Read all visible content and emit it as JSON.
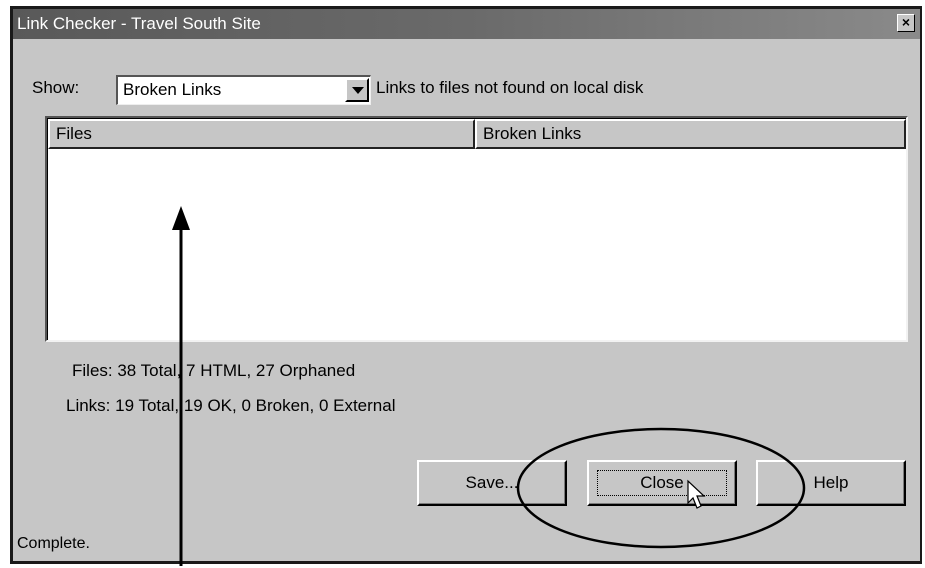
{
  "window": {
    "title": "Link Checker - Travel South Site",
    "close_glyph": "×"
  },
  "show": {
    "label": "Show:",
    "selected": "Broken Links",
    "description": "Links to files not found on local disk"
  },
  "list": {
    "columns": [
      "Files",
      "Broken Links"
    ],
    "rows": []
  },
  "stats": {
    "files": "Files: 38 Total,  7 HTML,  27 Orphaned",
    "links": "Links: 19 Total,  19 OK,  0 Broken,  0 External"
  },
  "buttons": {
    "save": "Save...",
    "close": "Close",
    "help": "Help"
  },
  "status": "Complete.",
  "colors": {
    "face": "#c6c6c6",
    "titlebar": "#6a6a6a"
  }
}
